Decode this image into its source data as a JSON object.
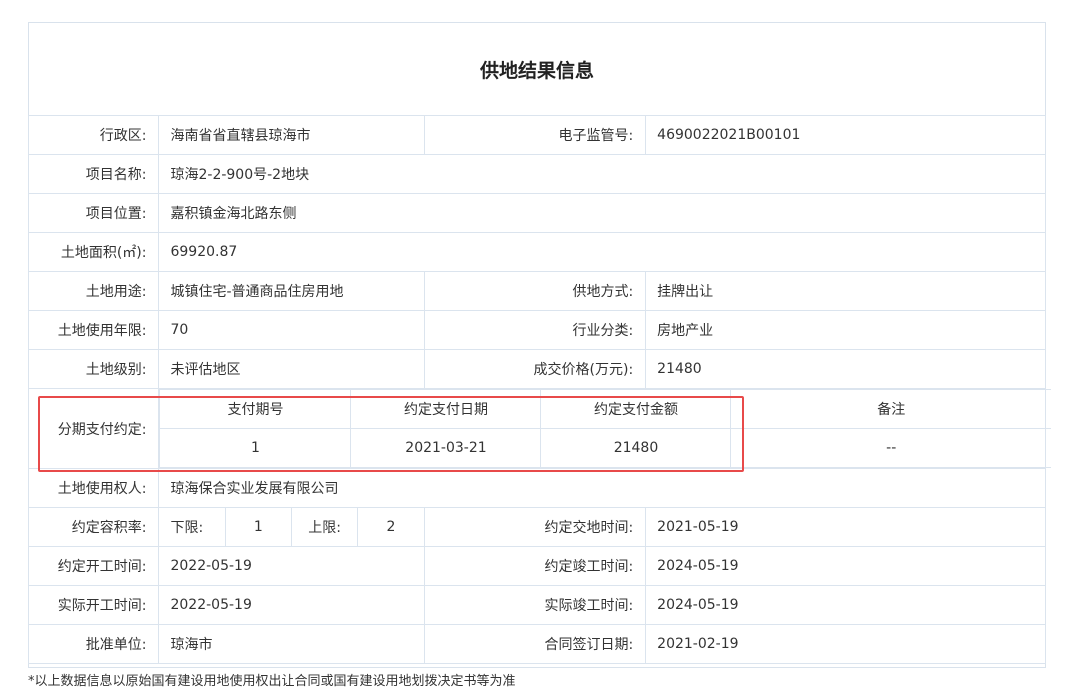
{
  "title": "供地结果信息",
  "rows": {
    "admin_label": "行政区:",
    "admin_value": "海南省省直辖县琼海市",
    "code_label": "电子监管号:",
    "code_value": "4690022021B00101",
    "name_label": "项目名称:",
    "name_value": "琼海2-2-900号-2地块",
    "location_label": "项目位置:",
    "location_value": "嘉积镇金海北路东侧",
    "area_label": "土地面积(㎡):",
    "area_value": "69920.87",
    "use_label": "土地用途:",
    "use_value": "城镇住宅-普通商品住房用地",
    "supply_label": "供地方式:",
    "supply_value": "挂牌出让",
    "years_label": "土地使用年限:",
    "years_value": "70",
    "industry_label": "行业分类:",
    "industry_value": "房地产业",
    "grade_label": "土地级别:",
    "grade_value": "未评估地区",
    "price_label": "成交价格(万元):",
    "price_value": "21480",
    "installment_label": "分期支付约定:",
    "installment_headers": [
      "支付期号",
      "约定支付日期",
      "约定支付金额",
      "备注"
    ],
    "installment_row": [
      "1",
      "2021-03-21",
      "21480",
      "--"
    ],
    "owner_label": "土地使用权人:",
    "owner_value": "琼海保合实业发展有限公司",
    "far_label": "约定容积率:",
    "far_lower_label": "下限:",
    "far_lower_value": "1",
    "far_upper_label": "上限:",
    "far_upper_value": "2",
    "handover_label": "约定交地时间:",
    "handover_value": "2021-05-19",
    "start_label": "约定开工时间:",
    "start_value": "2022-05-19",
    "finish_label": "约定竣工时间:",
    "finish_value": "2024-05-19",
    "actual_start_label": "实际开工时间:",
    "actual_start_value": "2022-05-19",
    "actual_finish_label": "实际竣工时间:",
    "actual_finish_value": "2024-05-19",
    "approver_label": "批准单位:",
    "approver_value": "琼海市",
    "contract_label": "合同签订日期:",
    "contract_value": "2021-02-19"
  },
  "footnote": "*以上数据信息以原始国有建设用地使用权出让合同或国有建设用地划拨决定书等为准",
  "colors": {
    "highlight": "#e84a4a",
    "border": "#dbe4ee"
  }
}
